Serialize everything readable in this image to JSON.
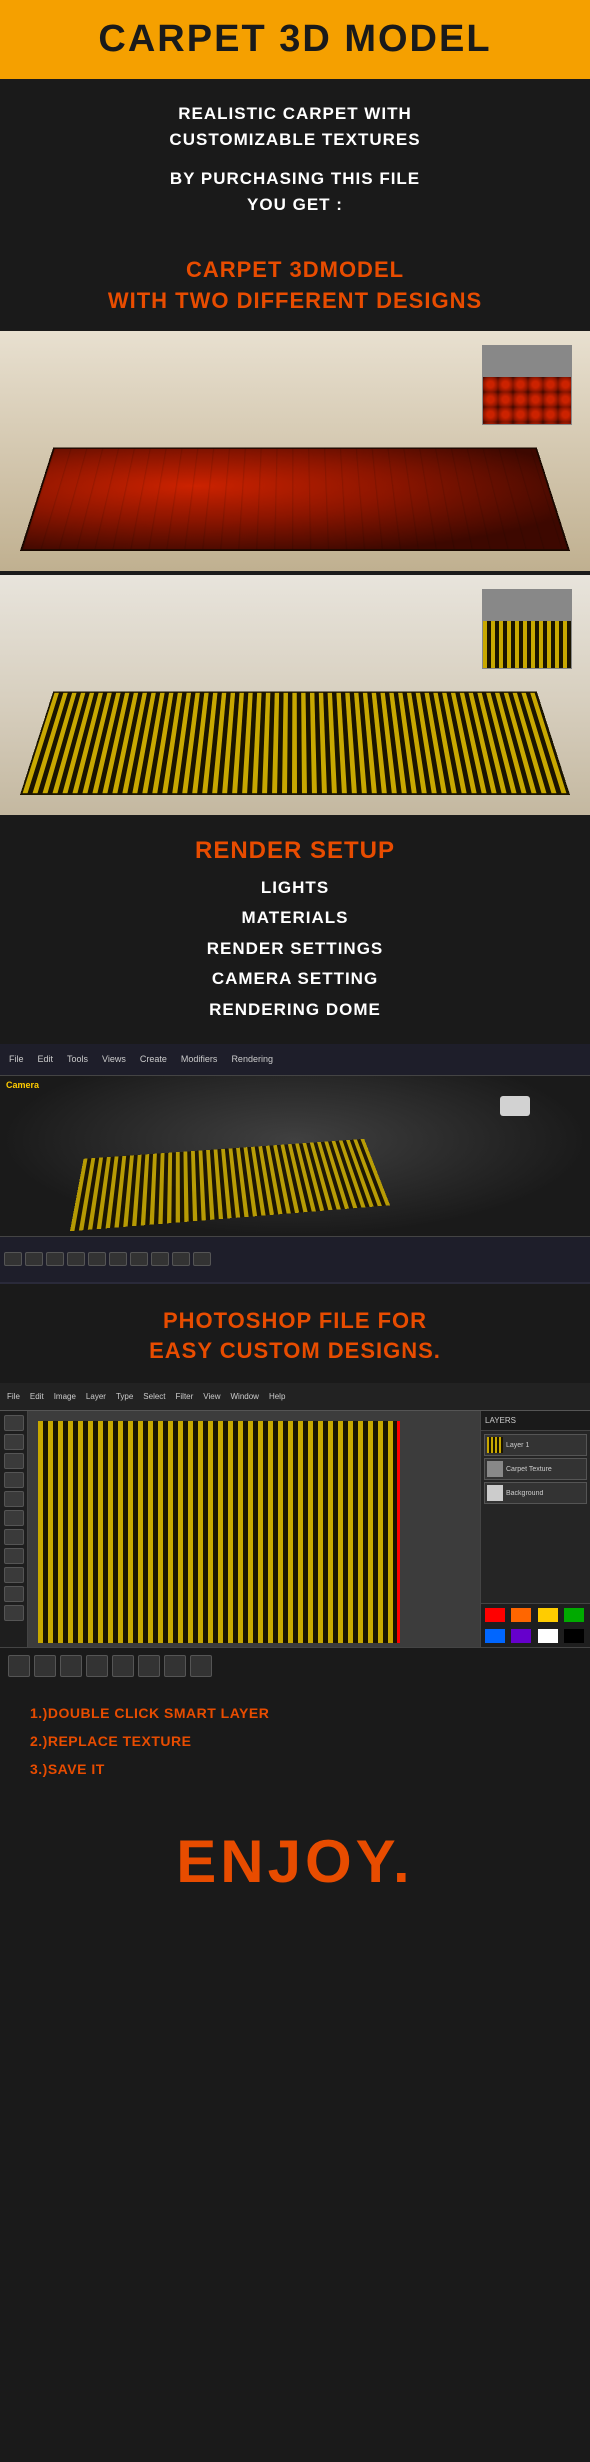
{
  "header": {
    "title": "Carpet 3D MODEL"
  },
  "intro": {
    "subtitle": "Realistic carpet with\ncustomizable textures",
    "purchasing": "By purchasing this file\nyou get :"
  },
  "features": {
    "heading_line1": "Carpet 3Dmodel",
    "heading_line2": "with two different designs"
  },
  "render_setup": {
    "title": "Render Setup",
    "items": [
      "Lights",
      "Materials",
      "Render Settings",
      "Camera Setting",
      "Rendering Dome"
    ]
  },
  "photoshop": {
    "title_line1": "Photoshop file for",
    "title_line2": "easy custom designs."
  },
  "instructions": {
    "item1": "1.)Double click smart layer",
    "item2": "2.)Replace texture",
    "item3": "3.)Save it"
  },
  "footer": {
    "enjoy": "ENJOY."
  },
  "ps_layers": [
    {
      "name": "Layer 1"
    },
    {
      "name": "Carpet Texture"
    },
    {
      "name": "Background"
    }
  ],
  "ps_colors": [
    "#ff0000",
    "#ff6600",
    "#ffcc00",
    "#00aa00",
    "#0066ff",
    "#6600cc",
    "#ffffff",
    "#000000",
    "#888888",
    "#cc4400"
  ]
}
